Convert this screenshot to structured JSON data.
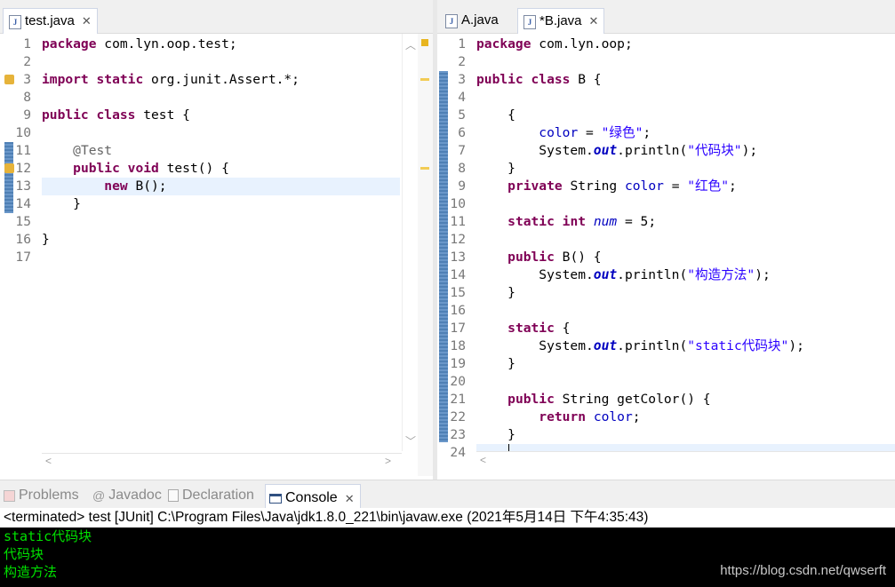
{
  "left_editor": {
    "tab": {
      "label": "test.java",
      "close": "✕"
    },
    "lines": [
      {
        "n": "1",
        "code": "<span class='kw'>package</span> com.lyn.oop.test;"
      },
      {
        "n": "2",
        "code": ""
      },
      {
        "n": "3",
        "code": "<span class='kw'>import</span> <span class='kw'>static</span> org.junit.Assert.*;"
      },
      {
        "n": "8",
        "code": ""
      },
      {
        "n": "9",
        "code": "<span class='kw'>public</span> <span class='kw'>class</span> test {"
      },
      {
        "n": "10",
        "code": ""
      },
      {
        "n": "11",
        "code": "    <span class='ann'>@Test</span>"
      },
      {
        "n": "12",
        "code": "    <span class='kw'>public</span> <span class='kw'>void</span> test() {"
      },
      {
        "n": "13",
        "code": "        <span class='kw'>new</span> B();"
      },
      {
        "n": "14",
        "code": "    }"
      },
      {
        "n": "15",
        "code": ""
      },
      {
        "n": "16",
        "code": "}"
      },
      {
        "n": "17",
        "code": ""
      }
    ]
  },
  "right_editor": {
    "tabs": [
      {
        "label": "A.java"
      },
      {
        "label": "*B.java",
        "close": "✕"
      }
    ],
    "lines": [
      {
        "n": "1",
        "code": "<span class='kw'>package</span> com.lyn.oop;"
      },
      {
        "n": "2",
        "code": ""
      },
      {
        "n": "3",
        "code": "<span class='kw'>public</span> <span class='kw'>class</span> B {"
      },
      {
        "n": "4",
        "code": ""
      },
      {
        "n": "5",
        "code": "    {"
      },
      {
        "n": "6",
        "code": "        <span class='fld'>color</span> = <span class='str'>\"绿色\"</span>;"
      },
      {
        "n": "7",
        "code": "        System.<span class='out'>out</span>.println(<span class='str'>\"代码块\"</span>);"
      },
      {
        "n": "8",
        "code": "    }"
      },
      {
        "n": "9",
        "code": "    <span class='kw'>private</span> String <span class='fld'>color</span> = <span class='str'>\"红色\"</span>;"
      },
      {
        "n": "10",
        "code": ""
      },
      {
        "n": "11",
        "code": "    <span class='kw'>static</span> <span class='kw'>int</span> <span class='sfld'>num</span> = 5;"
      },
      {
        "n": "12",
        "code": ""
      },
      {
        "n": "13",
        "code": "    <span class='kw'>public</span> B() {"
      },
      {
        "n": "14",
        "code": "        System.<span class='out'>out</span>.println(<span class='str'>\"构造方法\"</span>);"
      },
      {
        "n": "15",
        "code": "    }"
      },
      {
        "n": "16",
        "code": ""
      },
      {
        "n": "17",
        "code": "    <span class='kw'>static</span> {"
      },
      {
        "n": "18",
        "code": "        System.<span class='out'>out</span>.println(<span class='str'>\"static代码块\"</span>);"
      },
      {
        "n": "19",
        "code": "    }"
      },
      {
        "n": "20",
        "code": ""
      },
      {
        "n": "21",
        "code": "    <span class='kw'>public</span> String getColor() {"
      },
      {
        "n": "22",
        "code": "        <span class='kw'>return</span> <span class='fld'>color</span>;"
      },
      {
        "n": "23",
        "code": "    }"
      },
      {
        "n": "24",
        "code": ""
      }
    ]
  },
  "bottom_panel": {
    "tabs": [
      {
        "label": "Problems"
      },
      {
        "label": "Javadoc"
      },
      {
        "label": "Declaration"
      },
      {
        "label": "Console",
        "close": "✕"
      }
    ],
    "status": "<terminated> test [JUnit] C:\\Program Files\\Java\\jdk1.8.0_221\\bin\\javaw.exe (2021年5月14日 下午4:35:43)",
    "output": [
      "static代码块",
      "代码块",
      "构造方法"
    ],
    "watermark": "https://blog.csdn.net/qwserft"
  },
  "colors": {
    "keyword": "#7f0055",
    "string": "#2a00ff",
    "field": "#0000c0",
    "console_text": "#00e000"
  },
  "icons": [
    "java-file-icon",
    "close-icon",
    "problems-icon",
    "javadoc-icon",
    "declaration-icon",
    "console-icon",
    "warning-icon",
    "fold-icon",
    "scroll-up-icon",
    "scroll-down-icon",
    "scroll-left-icon",
    "scroll-right-icon"
  ]
}
